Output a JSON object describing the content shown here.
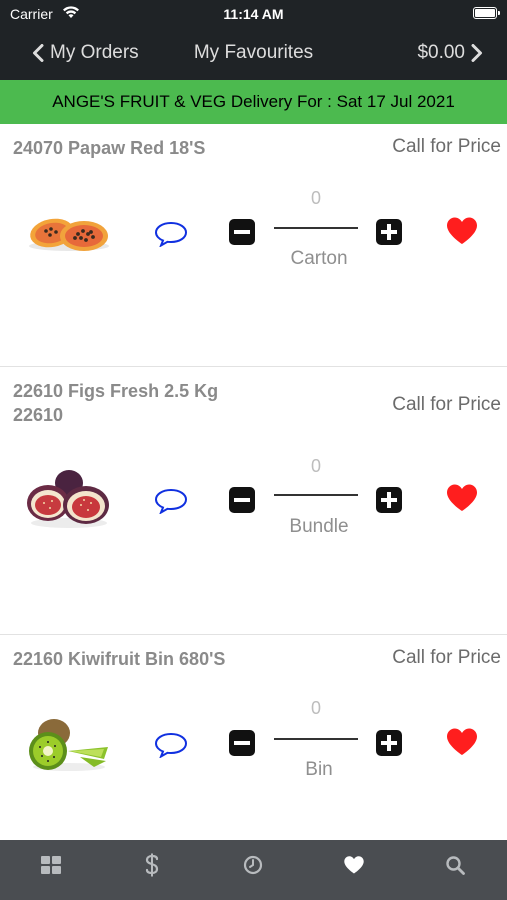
{
  "status_bar": {
    "carrier": "Carrier",
    "time": "11:14 AM"
  },
  "nav": {
    "back_label": "My Orders",
    "title": "My Favourites",
    "total": "$0.00"
  },
  "banner": {
    "text": "ANGE'S FRUIT & VEG Delivery For : Sat 17 Jul 2021"
  },
  "items": [
    {
      "name": "24070 Papaw Red 18'S",
      "price": "Call for Price",
      "quantity": "0",
      "unit": "Carton",
      "image": "papaya-image",
      "favourite": true
    },
    {
      "name": "22610 Figs Fresh 2.5 Kg  22610",
      "price": "Call for Price",
      "quantity": "0",
      "unit": "Bundle",
      "image": "figs-image",
      "favourite": true
    },
    {
      "name": "22160 Kiwifruit Bin 680'S",
      "price": "Call for Price",
      "quantity": "0",
      "unit": "Bin",
      "image": "kiwifruit-image",
      "favourite": true
    }
  ],
  "tab_bar": {
    "tabs": [
      {
        "icon": "grid-icon",
        "active": false
      },
      {
        "icon": "dollar-icon",
        "active": false
      },
      {
        "icon": "clock-icon",
        "active": false
      },
      {
        "icon": "heart-icon",
        "active": true
      },
      {
        "icon": "search-icon",
        "active": false
      }
    ]
  },
  "colors": {
    "banner": "#4cba4f",
    "bars": "#1f2326",
    "tab_bar": "#4a4d51",
    "heart": "#ff1e1e",
    "comment": "#1030e0"
  }
}
